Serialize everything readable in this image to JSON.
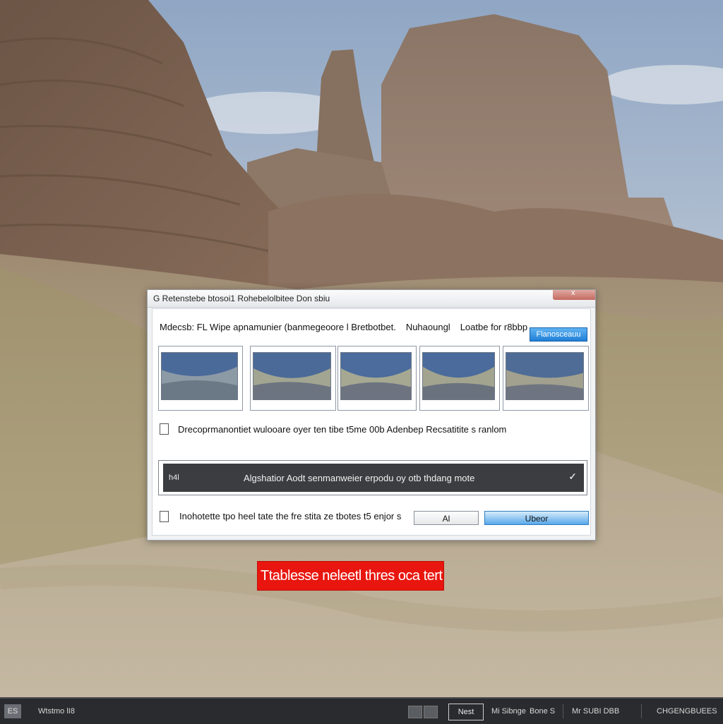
{
  "dialog": {
    "title": "G Retenstebe btosoi1 Rohebelolbitee Don sbiu",
    "close_label": "x",
    "header_text_1": "Mdecsb: FL Wipe apnamunier (banmegeoore l Bretbotbet.",
    "header_text_2": "Nuhaoungl",
    "header_text_3": "Loatbe for r8bbp",
    "top_button_label": "Flanosceauu",
    "thumbnails": [
      {
        "label": "thumbnail-1"
      },
      {
        "label": "thumbnail-2"
      },
      {
        "label": "thumbnail-3"
      },
      {
        "label": "thumbnail-4"
      },
      {
        "label": "thumbnail-5"
      }
    ],
    "option_label": "Drecoprmanontiet wulooare oyer ten tibe t5me 00b Adenbep Recsatitite s ranlom",
    "select": {
      "prefix": "h4l",
      "value": "Algshatior Aodt senmanweier erpodu oy otb thdang mote"
    },
    "footer_check_label": "Inohotette tpo heel tate the fre stita ze tbotes t5 enjor s",
    "secondary_button_label": "Al",
    "primary_button_label": "Ubeor"
  },
  "toast": {
    "text": "Ttablesse neleetl thres oca tert",
    "color": "#e8160e"
  },
  "taskbar": {
    "start_label": "ES",
    "app_label": "Wtstmo lI8",
    "button_label": "Nest",
    "item_1": "Mi Sibnge",
    "item_2": "Bone S",
    "item_3": "Mr SUBI DBB",
    "item_4": "CHGENGBUEES"
  },
  "colors": {
    "accent_blue": "#1f7fd6",
    "toast_red": "#e8160e",
    "taskbar_bg": "#2a2b2e"
  }
}
